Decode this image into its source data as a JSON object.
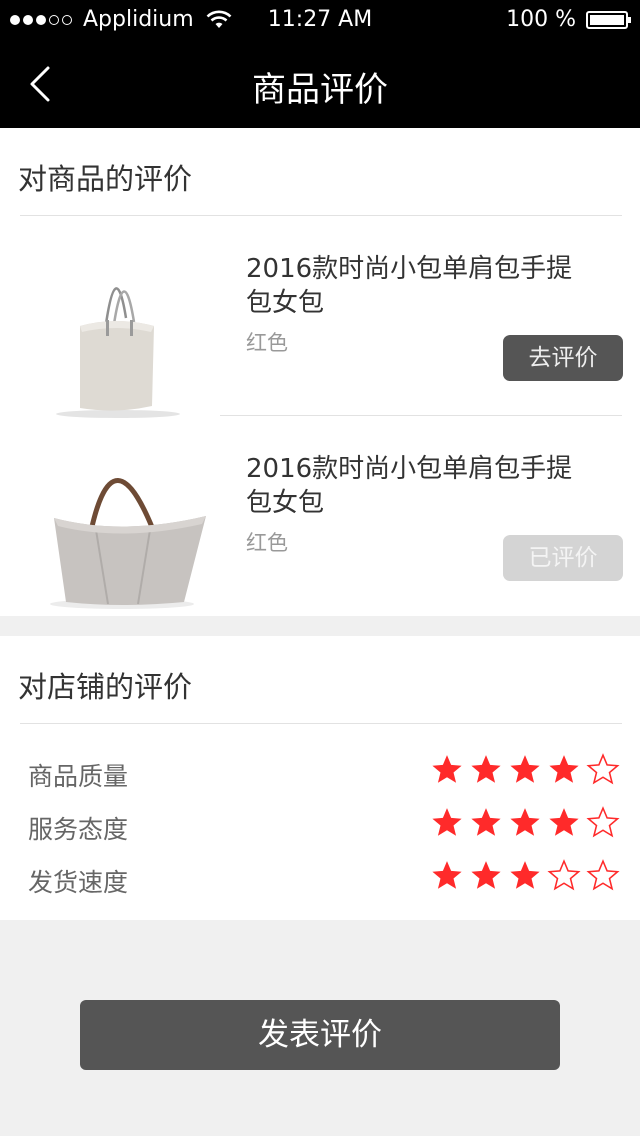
{
  "status_bar": {
    "carrier": "Applidium",
    "time": "11:27 AM",
    "battery": "100 %",
    "signal_icon": "signal-dots-icon",
    "wifi_icon": "wifi-icon",
    "battery_icon": "battery-icon"
  },
  "nav": {
    "title": "商品评价",
    "back_icon": "chevron-left-icon"
  },
  "goods_review": {
    "title": "对商品的评价",
    "products": [
      {
        "name": "2016款时尚小包单肩包手提包女包",
        "color": "红色",
        "button": "去评价",
        "button_state": "active"
      },
      {
        "name": "2016款时尚小包单肩包手提包女包",
        "color": "红色",
        "button": "已评价",
        "button_state": "done"
      }
    ]
  },
  "shop_review": {
    "title": "对店铺的评价",
    "ratings": [
      {
        "label": "商品质量",
        "stars": 4,
        "max": 5
      },
      {
        "label": "服务态度",
        "stars": 4,
        "max": 5
      },
      {
        "label": "发货速度",
        "stars": 3,
        "max": 5
      }
    ]
  },
  "colors": {
    "star_filled": "#ff2a2a",
    "star_empty_stroke": "#ff2a2a",
    "primary_button": "#555555",
    "disabled_button": "#d4d4d4"
  },
  "submit_label": "发表评价"
}
